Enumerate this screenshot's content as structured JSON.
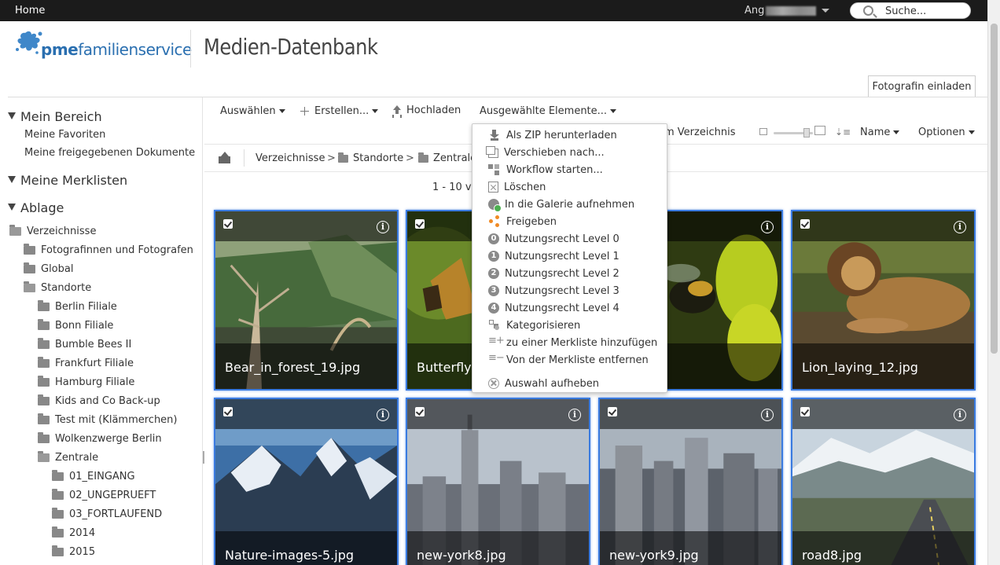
{
  "topbar": {
    "home_label": "Home",
    "user_name_visible": "Ang",
    "search_placeholder": "Suche..."
  },
  "header": {
    "brand_prefix": "pme",
    "brand_suffix": "familienservice",
    "app_title": "Medien-Datenbank",
    "invite_button": "Fotografin einladen",
    "brand_color": "#2a6fb0"
  },
  "sidebar": {
    "mein_bereich": {
      "title": "Mein Bereich",
      "links": [
        "Meine Favoriten",
        "Meine freigegebenen Dokumente"
      ]
    },
    "merklisten_title": "Meine Merklisten",
    "ablage_title": "Ablage",
    "tree": [
      {
        "label": "Verzeichnisse",
        "level": 0
      },
      {
        "label": "Fotografinnen und Fotografen",
        "level": 1
      },
      {
        "label": "Global",
        "level": 1
      },
      {
        "label": "Standorte",
        "level": 1
      },
      {
        "label": "Berlin Filiale",
        "level": 2
      },
      {
        "label": "Bonn Filiale",
        "level": 2
      },
      {
        "label": "Bumble Bees II",
        "level": 2
      },
      {
        "label": "Frankfurt Filiale",
        "level": 2
      },
      {
        "label": "Hamburg Filiale",
        "level": 2
      },
      {
        "label": "Kids and Co Back-up",
        "level": 2
      },
      {
        "label": "Test mit (Klämmerchen)",
        "level": 2
      },
      {
        "label": "Wolkenzwerge Berlin",
        "level": 2
      },
      {
        "label": "Zentrale",
        "level": 2
      },
      {
        "label": "01_EINGANG",
        "level": 3
      },
      {
        "label": "02_UNGEPRUEFT",
        "level": 3
      },
      {
        "label": "03_FORTLAUFEND",
        "level": 3
      },
      {
        "label": "2014",
        "level": 3
      },
      {
        "label": "2015",
        "level": 3
      }
    ]
  },
  "toolbar": {
    "select_label": "Auswählen",
    "create_label": "Erstellen...",
    "upload_label": "Hochladen",
    "selected_items_label": "Ausgewählte Elemente...",
    "directory_partial": "m Verzeichnis",
    "sort_label": "Name",
    "options_label": "Optionen"
  },
  "breadcrumb": {
    "items": [
      "Verzeichnisse",
      "Standorte",
      "Zentrale"
    ],
    "separator": ">"
  },
  "count_partial": "1 - 10 vo",
  "tiles": [
    {
      "name": "Bear_in_forest_19.jpg"
    },
    {
      "name": "Butterflyin"
    },
    {
      "name": ""
    },
    {
      "name": "Lion_laying_12.jpg"
    },
    {
      "name": "Nature-images-5.jpg"
    },
    {
      "name": "new-york8.jpg"
    },
    {
      "name": "new-york9.jpg"
    },
    {
      "name": "road8.jpg"
    }
  ],
  "dropdown": {
    "items": [
      {
        "label": "Als ZIP herunterladen",
        "icon": "download-icon"
      },
      {
        "label": "Verschieben nach...",
        "icon": "move-icon"
      },
      {
        "label": "Workflow starten...",
        "icon": "workflow-icon"
      },
      {
        "label": "Löschen",
        "icon": "delete-icon"
      },
      {
        "label": "In die Galerie aufnehmen",
        "icon": "gallery-icon"
      },
      {
        "label": "Freigeben",
        "icon": "share-icon"
      },
      {
        "label": "Nutzungsrecht Level 0",
        "icon": "level-0-icon",
        "num": "0"
      },
      {
        "label": "Nutzungsrecht Level 1",
        "icon": "level-1-icon",
        "num": "1"
      },
      {
        "label": "Nutzungsrecht Level 2",
        "icon": "level-2-icon",
        "num": "2"
      },
      {
        "label": "Nutzungsrecht Level 3",
        "icon": "level-3-icon",
        "num": "3"
      },
      {
        "label": "Nutzungsrecht Level 4",
        "icon": "level-4-icon",
        "num": "4"
      },
      {
        "label": "Kategorisieren",
        "icon": "categorize-icon"
      },
      {
        "label": "zu einer Merkliste hinzufügen",
        "icon": "list-add-icon"
      },
      {
        "label": "Von der Merkliste entfernen",
        "icon": "list-remove-icon"
      },
      {
        "label": "Auswahl aufheben",
        "icon": "clear-selection-icon"
      }
    ]
  },
  "colors": {
    "selection_border": "#3a7be0",
    "share_icon": "#f08a24",
    "topbar_bg": "#1b1b1b"
  }
}
